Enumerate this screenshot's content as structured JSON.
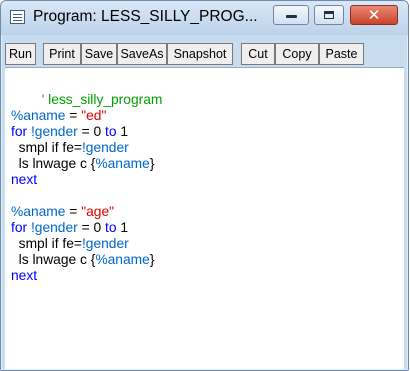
{
  "window": {
    "title": "Program: LESS_SILLY_PROG...",
    "icon": "program-icon",
    "controls": {
      "minimize": "minimize-icon",
      "maximize": "maximize-icon",
      "close": "close-icon"
    }
  },
  "toolbar": {
    "run": "Run",
    "print": "Print",
    "save": "Save",
    "saveas": "SaveAs",
    "snapshot": "Snapshot",
    "cut": "Cut",
    "copy": "Copy",
    "paste": "Paste"
  },
  "code": {
    "comment": "' less_silly_program",
    "block1": {
      "assign_var": "%aname",
      "assign_eq": " = ",
      "assign_str": "\"ed\"",
      "for_kw": "for",
      "for_var": " !gender",
      "for_eq": " = 0 ",
      "for_to": "to",
      "for_end": " 1",
      "smpl_text": "  smpl if fe=",
      "smpl_var": "!gender",
      "ls_text": "  ls lnwage c {",
      "ls_var": "%aname",
      "ls_close": "}",
      "next_kw": "next"
    },
    "block2": {
      "assign_var": "%aname",
      "assign_eq": " = ",
      "assign_str": "\"age\"",
      "for_kw": "for",
      "for_var": " !gender",
      "for_eq": " = 0 ",
      "for_to": "to",
      "for_end": " 1",
      "smpl_text": "  smpl if fe=",
      "smpl_var": "!gender",
      "ls_text": "  ls lnwage c {",
      "ls_var": "%aname",
      "ls_close": "}",
      "next_kw": "next"
    }
  },
  "colors": {
    "comment": "#00a000",
    "variable": "#0066cc",
    "keyword": "#0000ff",
    "string": "#e00000"
  }
}
